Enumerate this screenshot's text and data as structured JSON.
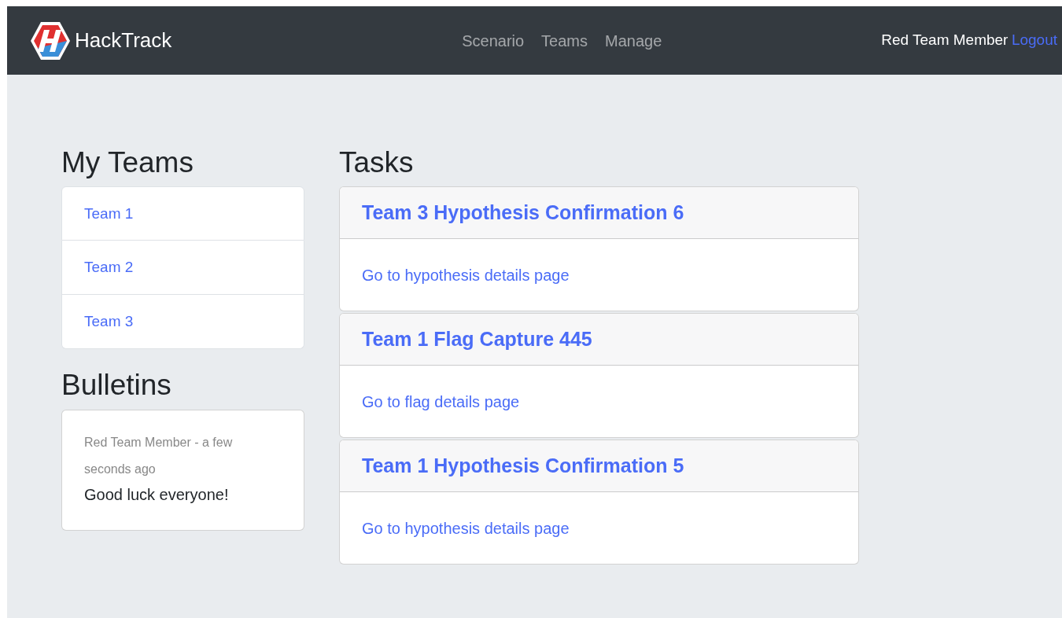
{
  "navbar": {
    "brand": "HackTrack",
    "links": [
      {
        "label": "Scenario"
      },
      {
        "label": "Teams"
      },
      {
        "label": "Manage"
      }
    ],
    "user": "Red Team Member",
    "logout": "Logout"
  },
  "my_teams": {
    "title": "My Teams",
    "items": [
      {
        "label": "Team 1"
      },
      {
        "label": "Team 2"
      },
      {
        "label": "Team 3"
      }
    ]
  },
  "bulletins": {
    "title": "Bulletins",
    "items": [
      {
        "meta": "Red Team Member - a few seconds ago",
        "message": "Good luck everyone!"
      }
    ]
  },
  "tasks": {
    "title": "Tasks",
    "items": [
      {
        "title": "Team 3 Hypothesis Confirmation 6",
        "link": "Go to hypothesis details page"
      },
      {
        "title": "Team 1 Flag Capture 445",
        "link": "Go to flag details page"
      },
      {
        "title": "Team 1 Hypothesis Confirmation 5",
        "link": "Go to hypothesis details page"
      }
    ]
  }
}
